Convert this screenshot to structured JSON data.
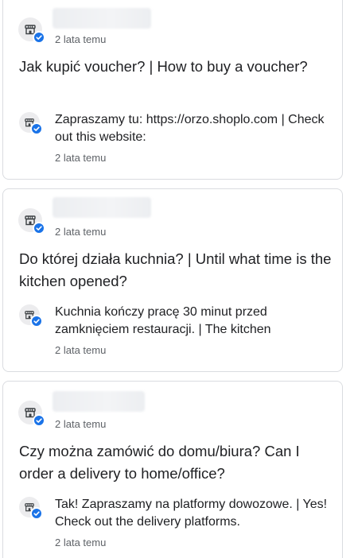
{
  "qa": [
    {
      "author_relative_time": "2 lata temu",
      "question": "Jak kupić voucher? | How to buy a voucher?",
      "answer": {
        "text": "Zapraszamy tu: https://orzo.shoplo.com | Check out this website:",
        "relative_time": "2 lata temu"
      }
    },
    {
      "author_relative_time": "2 lata temu",
      "question": "Do której działa kuchnia? | Until what time is the kitchen opened?",
      "answer": {
        "text": "Kuchnia kończy pracę 30 minut przed zamknięciem restauracji. | The kitchen",
        "relative_time": "2 lata temu"
      }
    },
    {
      "author_relative_time": "2 lata temu",
      "question": "Czy można zamówić do domu/biura? Can I order a delivery to home/office?",
      "answer": {
        "text": "Tak! Zapraszamy na platformy dowozowe. | Yes! Check out the delivery platforms.",
        "relative_time": "2 lata temu"
      }
    }
  ],
  "icons": {
    "avatar": "store-icon",
    "badge": "verified-check-icon"
  },
  "colors": {
    "badge": "#1a73e8",
    "border": "#dadce0",
    "secondary_text": "#5f6368",
    "primary_text": "#202124"
  }
}
